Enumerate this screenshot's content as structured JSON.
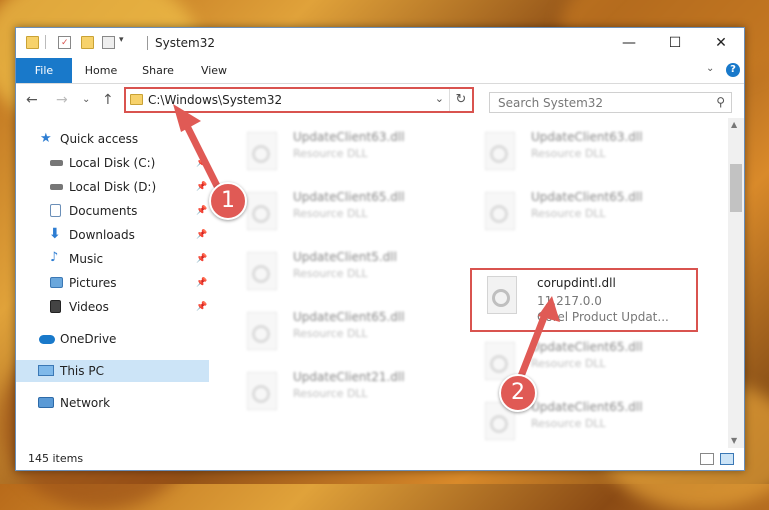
{
  "window": {
    "title": "System32",
    "minimize": "—",
    "maximize": "☐",
    "close": "✕"
  },
  "ribbon": {
    "tabs": [
      "File",
      "Home",
      "Share",
      "View"
    ],
    "expand_glyph": "⌄",
    "help_glyph": "?"
  },
  "nav": {
    "back": "←",
    "forward": "→",
    "recent": "⌄",
    "up": "↑",
    "address": "C:\\Windows\\System32",
    "address_dropdown": "⌄",
    "refresh": "↻",
    "search_placeholder": "Search System32",
    "search_glyph": "⚲"
  },
  "sidebar": {
    "items": [
      {
        "label": "Quick access",
        "icon": "star-icon"
      },
      {
        "label": "Local Disk (C:)",
        "icon": "drive-icon"
      },
      {
        "label": "Local Disk (D:)",
        "icon": "drive-icon"
      },
      {
        "label": "Documents",
        "icon": "documents-icon"
      },
      {
        "label": "Downloads",
        "icon": "downloads-icon"
      },
      {
        "label": "Music",
        "icon": "music-icon"
      },
      {
        "label": "Pictures",
        "icon": "pictures-icon"
      },
      {
        "label": "Videos",
        "icon": "videos-icon"
      },
      {
        "label": "OneDrive",
        "icon": "cloud-icon"
      },
      {
        "label": "This PC",
        "icon": "computer-icon"
      },
      {
        "label": "Network",
        "icon": "network-icon"
      }
    ],
    "pin_glyph": "📌"
  },
  "files": {
    "left": [
      {
        "name": "UpdateClient63.dll",
        "desc": "Resource DLL"
      },
      {
        "name": "UpdateClient65.dll",
        "desc": "Resource DLL"
      },
      {
        "name": "UpdateClient5.dll",
        "desc": "Resource DLL"
      },
      {
        "name": "UpdateClient65.dll",
        "desc": "Resource DLL"
      },
      {
        "name": "UpdateClient21.dll",
        "desc": "Resource DLL"
      }
    ],
    "right": [
      {
        "name": "UpdateClient63.dll",
        "desc": "Resource DLL"
      },
      {
        "name": "UpdateClient65.dll",
        "desc": "Resource DLL"
      },
      {
        "name": "UpdateClient65.dll",
        "desc": "Resource DLL"
      },
      {
        "name": "UpdateClient65.dll",
        "desc": "Resource DLL"
      }
    ],
    "selected": {
      "name": "corupdintl.dll",
      "version": "11.217.0.0",
      "description": "Corel Product Updat..."
    }
  },
  "status": {
    "count": "145 items"
  },
  "callouts": [
    "1",
    "2"
  ],
  "colors": {
    "accent": "#1979ca",
    "highlight": "#d9534f",
    "selected_bg": "#cce4f7"
  }
}
